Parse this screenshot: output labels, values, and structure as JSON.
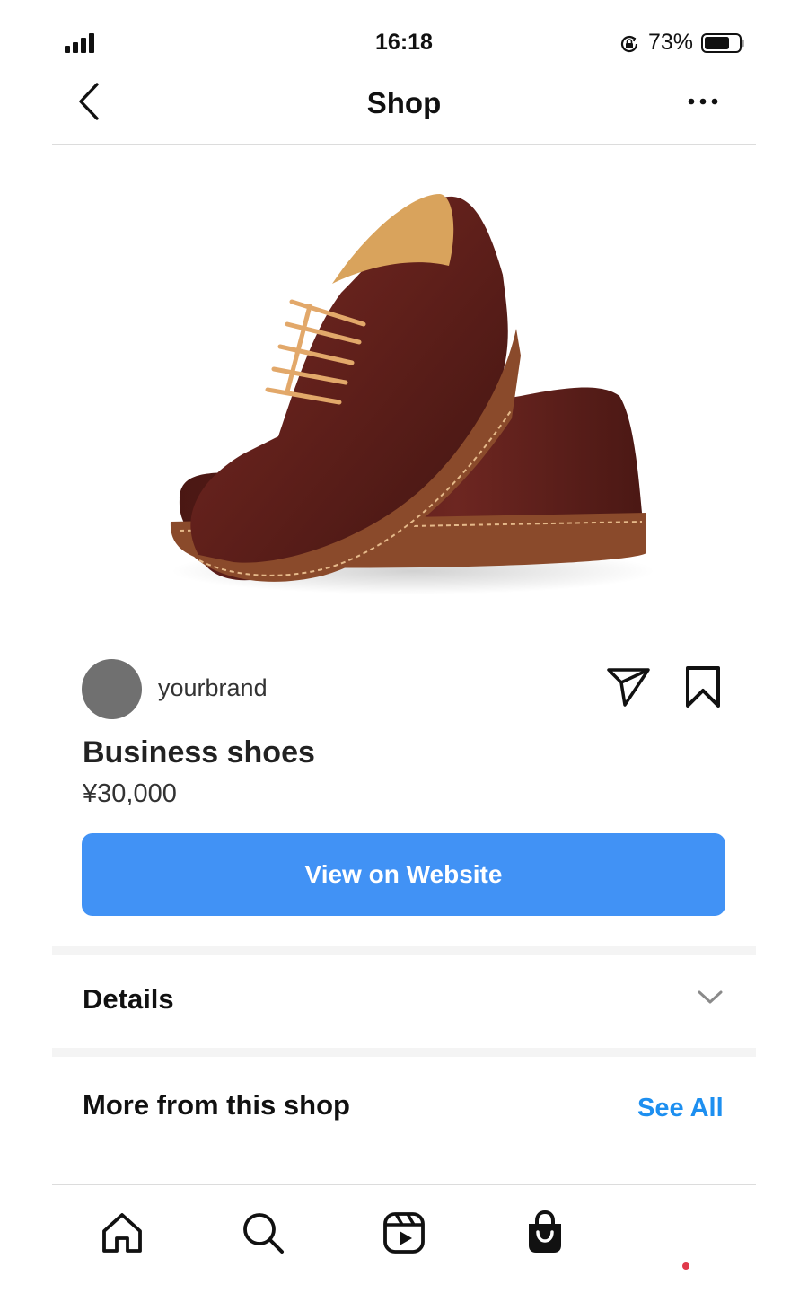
{
  "status_bar": {
    "time": "16:18",
    "battery_percent": "73%",
    "battery_level": 0.73,
    "icons": [
      "signal-icon",
      "orientation-lock-icon",
      "battery-icon"
    ]
  },
  "nav": {
    "title": "Shop",
    "back_icon": "chevron-left-icon",
    "more_icon": "ellipsis-icon"
  },
  "product": {
    "image": "brown-leather-derby-shoes",
    "brand": "yourbrand",
    "name": "Business shoes",
    "price": "¥30,000",
    "cta_label": "View on Website"
  },
  "sections": {
    "details_label": "Details",
    "more_from_shop_title": "More from this shop",
    "see_all_label": "See All"
  },
  "tab_bar": {
    "tabs": [
      "home-icon",
      "search-icon",
      "reels-icon",
      "shop-bag-icon"
    ],
    "active": "shop-bag-icon"
  },
  "colors": {
    "accent": "#4192f5",
    "link": "#1d8ff0",
    "notification_dot": "#e0394a",
    "avatar": "#707070"
  }
}
